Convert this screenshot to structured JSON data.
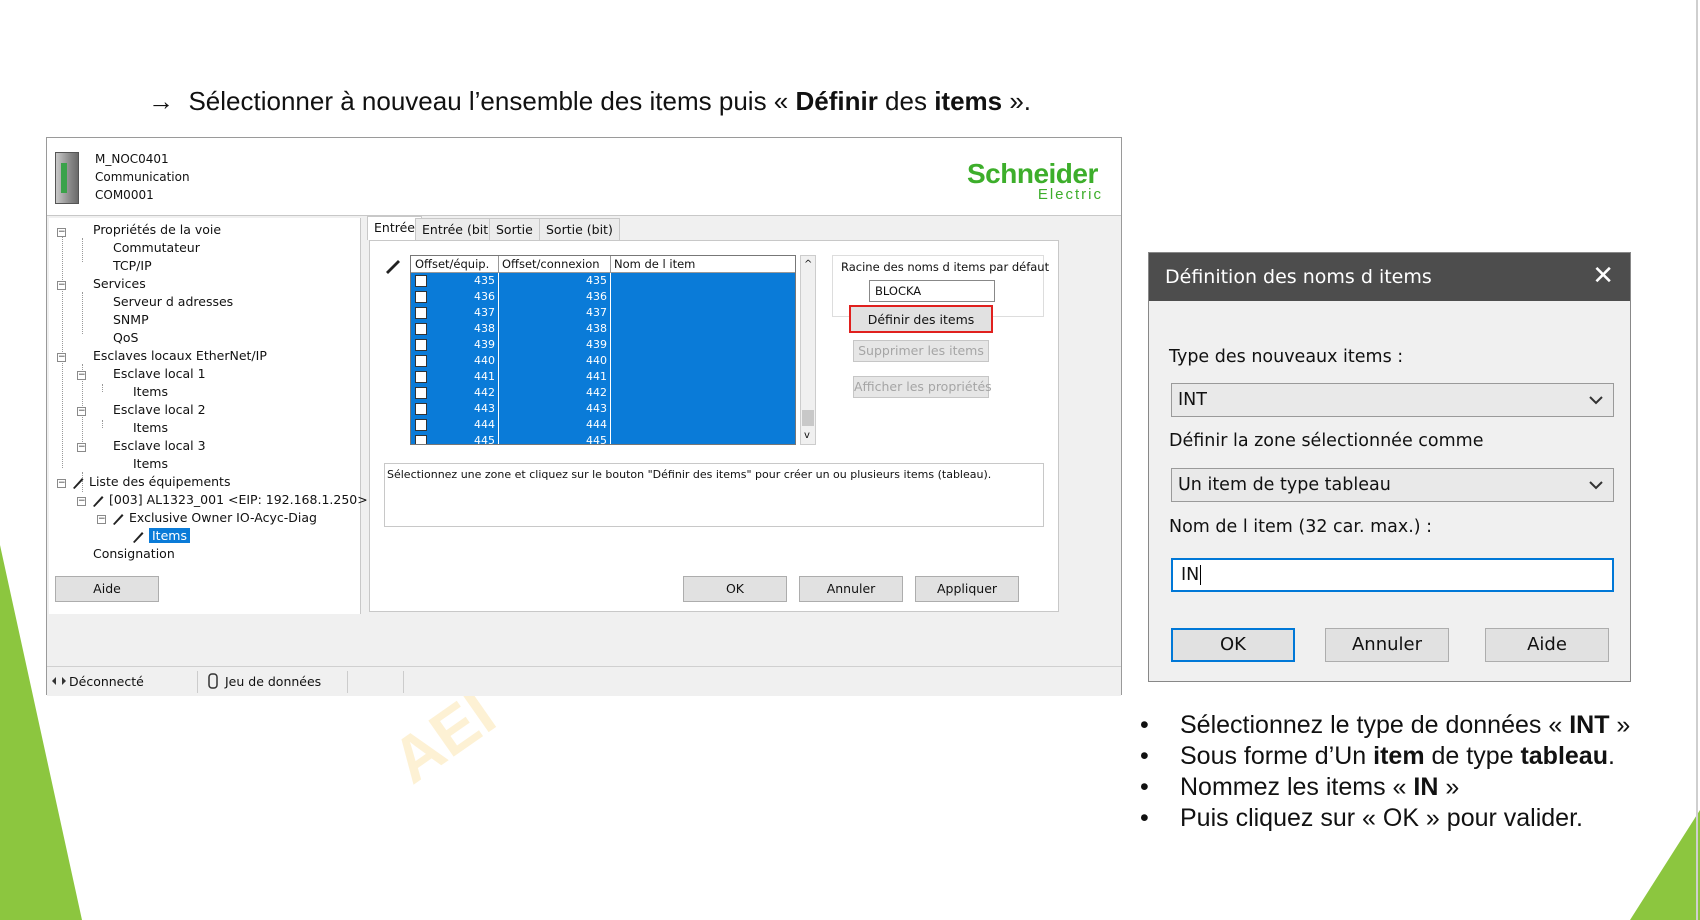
{
  "slide": {
    "heading": {
      "arrow": "→",
      "text_1": "Sélectionner à nouveau l’ensemble des items puis « ",
      "bold_1": "Définir",
      "text_2": " des ",
      "bold_2": "items",
      "text_3": " »."
    },
    "watermark": "AEI",
    "bullets": [
      {
        "t1": "Sélectionnez le type de données « ",
        "b1": "INT",
        "t2": " »"
      },
      {
        "t1": "Sous forme d’Un ",
        "b1": "item",
        "t2": " de type ",
        "b2": "tableau",
        "t3": "."
      },
      {
        "t1": "Nommez les items « ",
        "b1": "IN",
        "t2": " »"
      },
      {
        "t1": "Puis cliquez sur « OK » pour valider."
      }
    ],
    "colors": {
      "accent_green": "#8cc63f",
      "selection_blue": "#0a7bd8",
      "highlight_red": "#e0201e",
      "dialog_title_bg": "#4d4d4d"
    }
  },
  "config_window": {
    "header": {
      "line1": "M_NOC0401",
      "line2": "Communication",
      "line3": "COM0001",
      "brand": "Schneider",
      "brand_sub": "Electric"
    },
    "tree": {
      "proprietes": "Propriétés de la voie",
      "commutateur": "Commutateur",
      "tcpip": "TCP/IP",
      "services": "Services",
      "serveur": "Serveur d adresses",
      "snmp": "SNMP",
      "qos": "QoS",
      "esclaves": "Esclaves locaux EtherNet/IP",
      "local1": "Esclave local 1",
      "items1": "Items",
      "local2": "Esclave local 2",
      "items2": "Items",
      "local3": "Esclave local 3",
      "items3": "Items",
      "liste": "Liste des équipements",
      "device": "[003] AL1323_001 <EIP: 192.168.1.250>",
      "owner": "Exclusive Owner IO-Acyc-Diag",
      "items_sel": "Items",
      "consignation": "Consignation"
    },
    "tabs": [
      "Entrée",
      "Entrée (bit)",
      "Sortie",
      "Sortie (bit)"
    ],
    "grid": {
      "headers": [
        "Offset/équip.",
        "Offset/connexion",
        "Nom de l item"
      ],
      "rows": [
        [
          "435",
          "435",
          ""
        ],
        [
          "436",
          "436",
          ""
        ],
        [
          "437",
          "437",
          ""
        ],
        [
          "438",
          "438",
          ""
        ],
        [
          "439",
          "439",
          ""
        ],
        [
          "440",
          "440",
          ""
        ],
        [
          "441",
          "441",
          ""
        ],
        [
          "442",
          "442",
          ""
        ],
        [
          "443",
          "443",
          ""
        ],
        [
          "444",
          "444",
          ""
        ],
        [
          "445",
          "445",
          ""
        ]
      ]
    },
    "racine_label": "Racine des noms d items par défaut",
    "racine_value": "BLOCKA",
    "btn_definir": "Définir des items",
    "btn_supprimer": "Supprimer les items",
    "btn_afficher": "Afficher les propriétés",
    "info_text": "Sélectionnez une zone et cliquez sur le bouton \"Définir des items\" pour créer un ou plusieurs items (tableau).",
    "bottom": {
      "aide": "Aide",
      "ok": "OK",
      "annuler": "Annuler",
      "appliquer": "Appliquer"
    },
    "status": {
      "connexion": "Déconnecté",
      "donnees": "Jeu de données"
    }
  },
  "dialog": {
    "title": "Définition des noms d items",
    "close": "✕",
    "type_label": "Type des nouveaux items :",
    "type_value": "INT",
    "zone_label": "Définir la zone sélectionnée comme",
    "zone_value": "Un item de type tableau",
    "name_label": "Nom de l item (32 car. max.) :",
    "name_value": "IN",
    "ok": "OK",
    "annuler": "Annuler",
    "aide": "Aide"
  }
}
